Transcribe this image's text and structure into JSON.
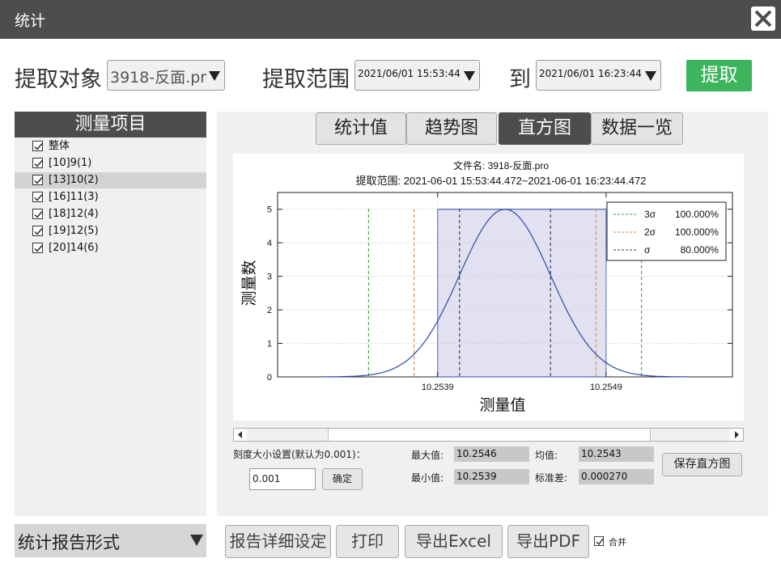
{
  "window": {
    "title": "统计"
  },
  "toolbar": {
    "target_label": "提取对象",
    "target_value": "3918-反面.pro",
    "range_label": "提取范围",
    "range_start": "2021/06/01 15:53:44",
    "to_label": "到",
    "range_end": "2021/06/01 16:23:44",
    "extract_label": "提取"
  },
  "items_panel": {
    "title": "测量项目",
    "items": [
      {
        "label": "整体",
        "checked": true
      },
      {
        "label": "[10]9(1)",
        "checked": true
      },
      {
        "label": "[13]10(2)",
        "checked": true,
        "selected": true
      },
      {
        "label": "[16]11(3)",
        "checked": true
      },
      {
        "label": "[18]12(4)",
        "checked": true
      },
      {
        "label": "[19]12(5)",
        "checked": true
      },
      {
        "label": "[20]14(6)",
        "checked": true
      }
    ]
  },
  "tabs": [
    {
      "label": "统计值",
      "active": false
    },
    {
      "label": "趋势图",
      "active": false
    },
    {
      "label": "直方图",
      "active": true
    },
    {
      "label": "数据一览",
      "active": false
    }
  ],
  "chart_data": {
    "type": "bar",
    "title": "文件名: 3918-反面.pro",
    "subtitle": "提取范围: 2021-06-01 15:53:44.472~2021-06-01 16:23:44.472",
    "xlabel": "测量值",
    "ylabel": "测量数",
    "ylim": [
      0,
      5.5
    ],
    "yticks": [
      0,
      1,
      2,
      3,
      4,
      5
    ],
    "xticks": [
      "10.2539",
      "10.2549"
    ],
    "grid": true,
    "legend_position": "top-right",
    "bins": [
      {
        "from": 10.2539,
        "to": 10.2549,
        "count": 5
      }
    ],
    "mean": 10.2543,
    "std": 0.00027,
    "curve": "normal",
    "sigma_lines": [
      {
        "name": "3σ",
        "value": "100.000%",
        "color": "#3aa64a"
      },
      {
        "name": "2σ",
        "value": "100.000%",
        "color": "#e8863a"
      },
      {
        "name": "σ",
        "value": "80.000%",
        "color": "#333355"
      }
    ],
    "bar_color": "#c8c8e6",
    "curve_color": "#2c4aa8"
  },
  "stats": {
    "scale_label": "刻度大小设置(默认为0.001)：",
    "scale_value": "0.001",
    "confirm_label": "确定",
    "max_label": "最大值:",
    "max_value": "10.2546",
    "min_label": "最小值:",
    "min_value": "10.2539",
    "mean_label": "均值:",
    "mean_value": "10.2543",
    "std_label": "标准差:",
    "std_value": "0.000270",
    "save_label": "保存直方图"
  },
  "bottom": {
    "report_format": "统计报告形式",
    "detail_label": "报告详细设定",
    "print_label": "打印",
    "excel_label": "导出Excel",
    "pdf_label": "导出PDF",
    "merge_label": "合并",
    "merge_checked": true
  }
}
